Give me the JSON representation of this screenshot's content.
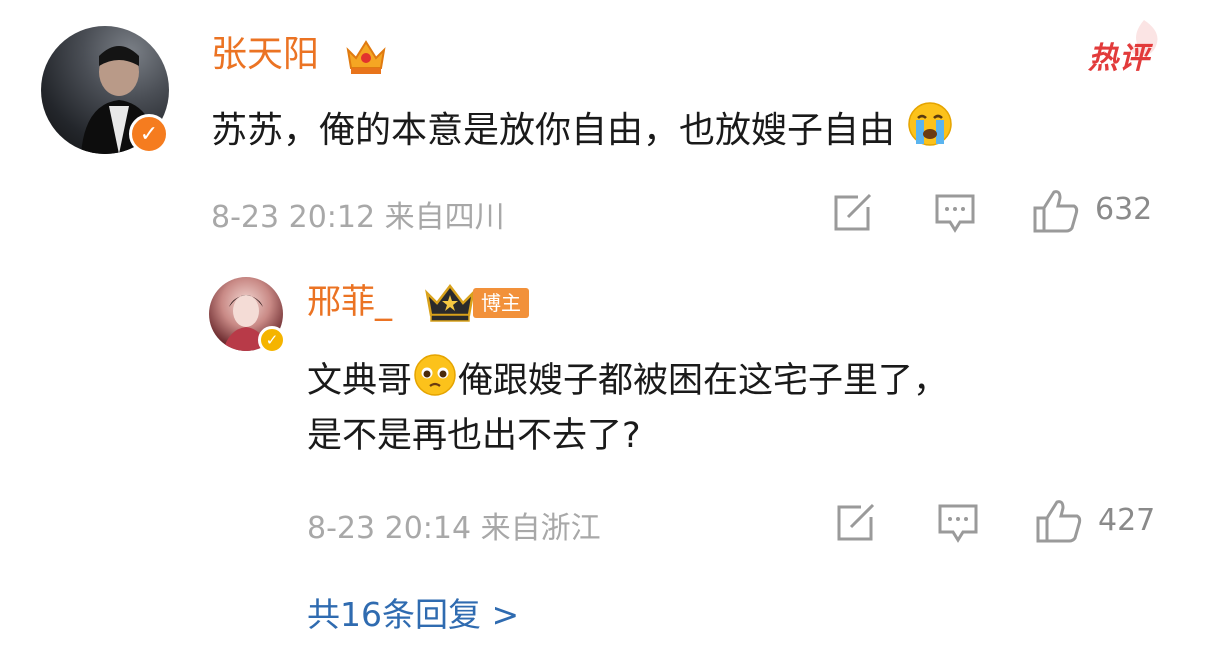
{
  "comments": [
    {
      "username": "张天阳",
      "hot_label": "热评",
      "text": "苏苏，俺的本意是放你自由，也放嫂子自由",
      "meta": "8-23 20:12 来自四川",
      "likes": "632"
    },
    {
      "username": "邢菲_",
      "badge": "博主",
      "text_a": "文典哥",
      "text_b": "俺跟嫂子都被困在这宅子里了，",
      "text_c": "是不是再也出不去了?",
      "meta": "8-23 20:14 来自浙江",
      "likes": "427"
    }
  ],
  "more_replies": "共16条回复 >",
  "colors": {
    "username": "#eb7323",
    "link": "#2f6bb0",
    "meta": "#a8a8a8",
    "hot": "#e23b3b"
  },
  "icons": [
    "verified-icon",
    "crown-icon",
    "crying-emoji-icon",
    "pleading-emoji-icon",
    "share-icon",
    "comment-icon",
    "like-icon"
  ]
}
